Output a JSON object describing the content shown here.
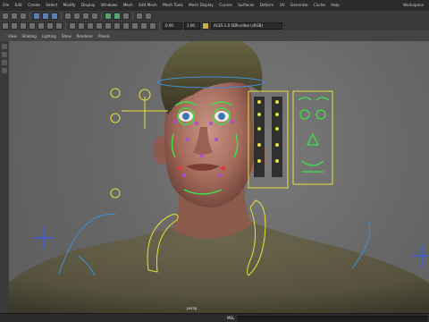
{
  "menus": {
    "items": [
      "File",
      "Edit",
      "Create",
      "Select",
      "Modify",
      "Display",
      "Windows",
      "Mesh",
      "Edit Mesh",
      "Mesh Tools",
      "Mesh Display",
      "Curves",
      "Surfaces",
      "Deform",
      "UV",
      "Generate",
      "Cache",
      "Help"
    ],
    "workspace_label": "Workspace"
  },
  "shelf": {
    "time_field_1": "0.00",
    "time_field_2": "1.00",
    "info_field": "ACES 1.0 SDR-video (sRGB)"
  },
  "panel": {
    "items": [
      "View",
      "Shading",
      "Lighting",
      "Show",
      "Renderer",
      "Panels"
    ]
  },
  "viewport": {
    "camera_label": "persp"
  },
  "status": {
    "mel_label": "MEL"
  }
}
